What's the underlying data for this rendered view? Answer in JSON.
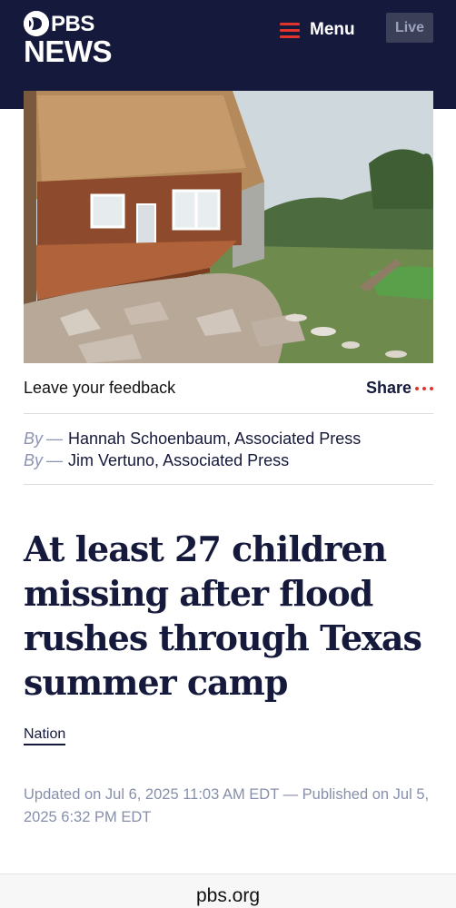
{
  "header": {
    "logo_top": "PBS",
    "logo_bottom": "NEWS",
    "menu_label": "Menu",
    "live_label": "Live",
    "colors": {
      "background": "#15193b",
      "accent": "#e1342d"
    }
  },
  "hero": {
    "icon": "flood-damaged-building-photo"
  },
  "actions": {
    "feedback": "Leave your feedback",
    "share": "Share"
  },
  "bylines": [
    {
      "by": "By",
      "dash": "—",
      "author": "Hannah Schoenbaum, Associated Press"
    },
    {
      "by": "By",
      "dash": "—",
      "author": "Jim Vertuno, Associated Press"
    }
  ],
  "article": {
    "headline_lines": [
      "At least 27 children",
      "missing after flood",
      "rushes through Texas",
      "summer camp"
    ],
    "section": "Nation",
    "dates": "Updated on Jul 6, 2025 11:03 AM EDT — Published on Jul 5, 2025 6:32 PM EDT"
  },
  "browser": {
    "url": "pbs.org"
  }
}
